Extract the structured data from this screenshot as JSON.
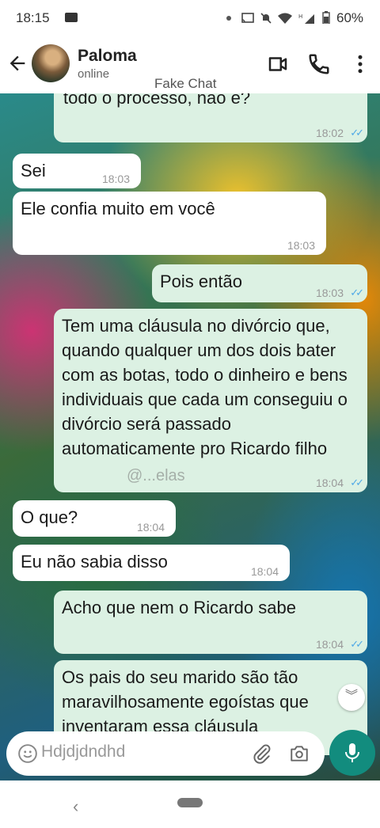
{
  "status_bar": {
    "time": "18:15",
    "battery": "60%",
    "icons": [
      "record-icon",
      "cast-icon",
      "mute-icon",
      "wifi-icon",
      "signal-icon",
      "battery-icon"
    ]
  },
  "header": {
    "contact_name": "Paloma",
    "contact_status": "online",
    "overlay_text": "Fake Chat"
  },
  "messages": [
    {
      "direction": "out",
      "text": "todo o processo, não é?",
      "time": "18:02",
      "read": true
    },
    {
      "direction": "in",
      "text": "Sei",
      "time": "18:03"
    },
    {
      "direction": "in",
      "text": "Ele confia muito em você",
      "time": "18:03"
    },
    {
      "direction": "out",
      "text": "Pois então",
      "time": "18:03",
      "read": true
    },
    {
      "direction": "out",
      "text": "Tem uma cláusula no divórcio que, quando qualquer um dos dois bater com as botas, todo o dinheiro e bens individuais que cada um conseguiu o divórcio será passado automaticamente pro Ricardo filho",
      "time": "18:04",
      "read": true
    },
    {
      "direction": "in",
      "text": "O que?",
      "time": "18:04"
    },
    {
      "direction": "in",
      "text": "Eu não sabia disso",
      "time": "18:04"
    },
    {
      "direction": "out",
      "text": "Acho que nem o Ricardo sabe",
      "time": "18:04",
      "read": true
    },
    {
      "direction": "out",
      "text": "Os pais do seu marido são tão maravilhosamente egoístas que inventaram essa cláusula",
      "time": "",
      "read": false
    }
  ],
  "watermark_text": "@...elas",
  "composer": {
    "draft": "Hdjdjdndhd"
  },
  "colors": {
    "incoming_bubble": "#ffffff",
    "outgoing_bubble": "#dcf1e3",
    "accent": "#128c7e",
    "read_ticks": "#4fa9e6"
  }
}
